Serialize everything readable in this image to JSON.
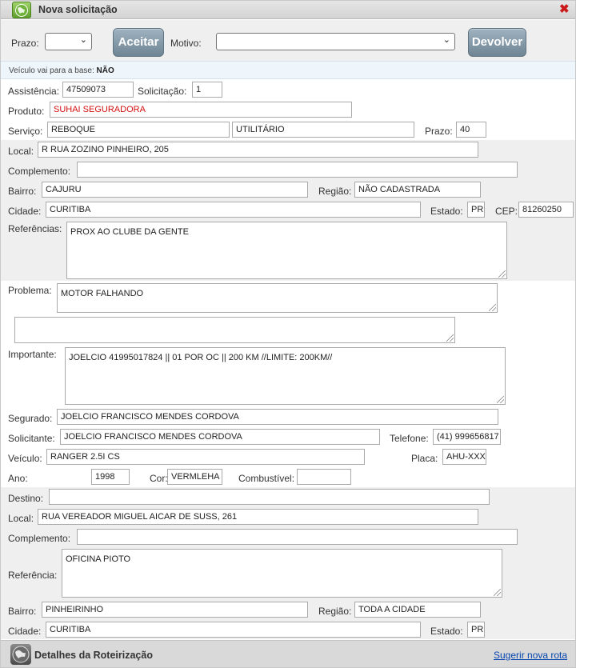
{
  "window": {
    "title": "Nova solicitação",
    "close_symbol": "✖"
  },
  "toolbar": {
    "prazo_label": "Prazo:",
    "prazo_value": "",
    "aceitar_label": "Aceitar",
    "motivo_label": "Motivo:",
    "motivo_value": "",
    "devolver_label": "Devolver"
  },
  "notice": {
    "text": "Veículo vai para a base:",
    "value": "NÃO"
  },
  "form": {
    "assistencia_label": "Assistência:",
    "assistencia": "47509073",
    "solicitacao_label": "Solicitação:",
    "solicitacao": "1",
    "produto_label": "Produto:",
    "produto": "SUHAI SEGURADORA",
    "servico_label": "Serviço:",
    "servico": "REBOQUE",
    "servico_tipo": "UTILITÁRIO",
    "prazo_label": "Prazo:",
    "prazo": "40",
    "local_label": "Local:",
    "local": "R RUA ZOZINO PINHEIRO, 205",
    "complemento_label": "Complemento:",
    "complemento": "",
    "bairro_label": "Bairro:",
    "bairro": "CAJURU",
    "regiao_label": "Região:",
    "regiao": "NÃO CADASTRADA",
    "cidade_label": "Cidade:",
    "cidade": "CURITIBA",
    "estado_label": "Estado:",
    "estado": "PR",
    "cep_label": "CEP:",
    "cep": "81260250",
    "referencias_label": "Referências:",
    "referencias": "PROX AO CLUBE DA GENTE",
    "problema_label": "Problema:",
    "problema": "MOTOR FALHANDO",
    "problema_extra": "",
    "importante_label": "Importante:",
    "importante": "JOELCIO 41995017824 || 01 POR OC || 200 KM  //LIMITE: 200KM//",
    "segurado_label": "Segurado:",
    "segurado": "JOELCIO FRANCISCO MENDES CORDOVA",
    "solicitante_label": "Solicitante:",
    "solicitante": "JOELCIO FRANCISCO MENDES CORDOVA",
    "telefone_label": "Telefone:",
    "telefone": "(41) 999656817",
    "veiculo_label": "Veículo:",
    "veiculo": "RANGER 2.5I CS",
    "placa_label": "Placa:",
    "placa": "AHU-XXXX",
    "ano_label": "Ano:",
    "ano": "1998",
    "cor_label": "Cor:",
    "cor": "VERMLEHA",
    "combustivel_label": "Combustível:",
    "combustivel": ""
  },
  "destino": {
    "destino_label": "Destino:",
    "destino": "",
    "local_label": "Local:",
    "local": "RUA VEREADOR MIGUEL AICAR DE SUSS, 261",
    "complemento_label": "Complemento:",
    "complemento": "",
    "referencia_label": "Referência:",
    "referencia": "OFICINA PIOTO",
    "bairro_label": "Bairro:",
    "bairro": "PINHEIRINHO",
    "regiao_label": "Região:",
    "regiao": "TODA A CIDADE",
    "cidade_label": "Cidade:",
    "cidade": "CURITIBA",
    "estado_label": "Estado:",
    "estado": "PR"
  },
  "footer": {
    "title": "Detalhes da Roteirização",
    "link": "Sugerir nova rota"
  },
  "colors": {
    "alert_red": "#d40f0f",
    "button": "#7d92a1",
    "band": "#efefef",
    "link": "#0645ad"
  }
}
